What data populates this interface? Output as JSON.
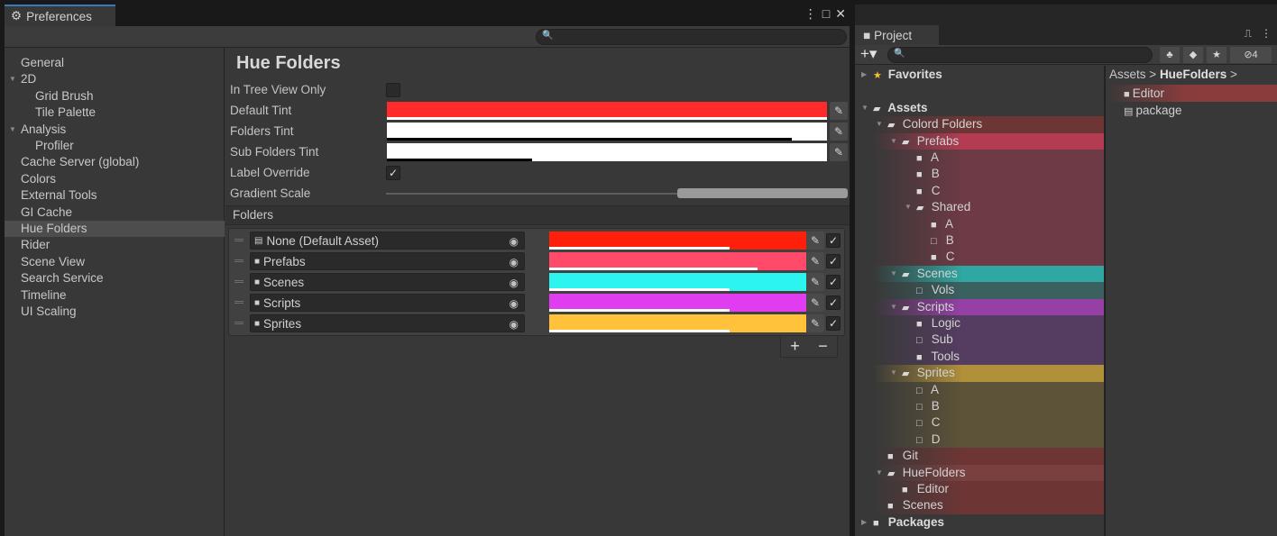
{
  "preferences": {
    "tab_title": "Preferences",
    "tab_icon": "gear-icon",
    "controls": [
      "⋮",
      "□",
      "✕"
    ],
    "sidebar": [
      {
        "label": "General",
        "indent": 0,
        "tri": ""
      },
      {
        "label": "2D",
        "indent": 0,
        "tri": "▼"
      },
      {
        "label": "Grid Brush",
        "indent": 1,
        "tri": ""
      },
      {
        "label": "Tile Palette",
        "indent": 1,
        "tri": ""
      },
      {
        "label": "Analysis",
        "indent": 0,
        "tri": "▼"
      },
      {
        "label": "Profiler",
        "indent": 1,
        "tri": ""
      },
      {
        "label": "Cache Server (global)",
        "indent": 0,
        "tri": ""
      },
      {
        "label": "Colors",
        "indent": 0,
        "tri": ""
      },
      {
        "label": "External Tools",
        "indent": 0,
        "tri": ""
      },
      {
        "label": "GI Cache",
        "indent": 0,
        "tri": ""
      },
      {
        "label": "Hue Folders",
        "indent": 0,
        "tri": "",
        "selected": true
      },
      {
        "label": "Rider",
        "indent": 0,
        "tri": ""
      },
      {
        "label": "Scene View",
        "indent": 0,
        "tri": ""
      },
      {
        "label": "Search Service",
        "indent": 0,
        "tri": ""
      },
      {
        "label": "Timeline",
        "indent": 0,
        "tri": ""
      },
      {
        "label": "UI Scaling",
        "indent": 0,
        "tri": ""
      }
    ],
    "page_title": "Hue Folders",
    "settings": {
      "in_tree_view_only": {
        "label": "In Tree View Only",
        "checked": false
      },
      "default_tint": {
        "label": "Default Tint",
        "color": "#ff2b2b",
        "bar_fraction": 1.0
      },
      "folders_tint": {
        "label": "Folders Tint",
        "color": "#ffffff",
        "bar_fraction": 0.92
      },
      "sub_folders_tint": {
        "label": "Sub Folders Tint",
        "color": "#ffffff",
        "bar_fraction": 0.33
      },
      "label_override": {
        "label": "Label Override",
        "checked": true
      },
      "gradient_scale": {
        "label": "Gradient Scale",
        "min": 0.0,
        "max": 1.0,
        "range": [
          0.63,
          1.0
        ]
      }
    },
    "folders_section": "Folders",
    "folders": [
      {
        "name": "None (Default Asset)",
        "icon": "file-icon",
        "color": "#ff1f0a",
        "bar_fraction": 0.7,
        "checked": true
      },
      {
        "name": "Prefabs",
        "icon": "folder-icon",
        "color": "#ff4a6a",
        "bar_fraction": 0.81,
        "checked": true
      },
      {
        "name": "Scenes",
        "icon": "folder-icon",
        "color": "#2cf5ef",
        "bar_fraction": 0.7,
        "checked": true
      },
      {
        "name": "Scripts",
        "icon": "folder-icon",
        "color": "#e03cf0",
        "bar_fraction": 0.7,
        "checked": true
      },
      {
        "name": "Sprites",
        "icon": "folder-icon",
        "color": "#ffc23a",
        "bar_fraction": 0.7,
        "checked": true
      }
    ],
    "footer": {
      "add": "+",
      "remove": "−"
    }
  },
  "project": {
    "tab_title": "Project",
    "controls": [
      "⎍",
      "⋮"
    ],
    "add_button": "+▾",
    "hidden_count": "4",
    "tree": [
      {
        "label": "Favorites",
        "depth": 0,
        "tri": "▶",
        "icon": "star-icon",
        "bold": true,
        "tint": null
      },
      {
        "label": "",
        "depth": 0,
        "tri": "",
        "icon": "",
        "bold": false,
        "tint": null
      },
      {
        "label": "Assets",
        "depth": 0,
        "tri": "▼",
        "icon": "open-folder-icon",
        "bold": true,
        "tint": null
      },
      {
        "label": "Colord Folders",
        "depth": 1,
        "tri": "▼",
        "icon": "open-folder-icon",
        "bold": false,
        "tint": "#6e3535"
      },
      {
        "label": "Prefabs",
        "depth": 2,
        "tri": "▼",
        "icon": "open-folder-icon",
        "bold": false,
        "tint": "#b43c52"
      },
      {
        "label": "A",
        "depth": 3,
        "tri": "",
        "icon": "folder-icon",
        "bold": false,
        "tint": "#6e3a45"
      },
      {
        "label": "B",
        "depth": 3,
        "tri": "",
        "icon": "folder-icon",
        "bold": false,
        "tint": "#6e3a45"
      },
      {
        "label": "C",
        "depth": 3,
        "tri": "",
        "icon": "folder-icon",
        "bold": false,
        "tint": "#6e3a45"
      },
      {
        "label": "Shared",
        "depth": 3,
        "tri": "▼",
        "icon": "open-folder-icon",
        "bold": false,
        "tint": "#6e3a45"
      },
      {
        "label": "A",
        "depth": 4,
        "tri": "",
        "icon": "folder-icon",
        "bold": false,
        "tint": "#6e3a45"
      },
      {
        "label": "B",
        "depth": 4,
        "tri": "",
        "icon": "empty-folder-icon",
        "bold": false,
        "tint": "#6e3a45"
      },
      {
        "label": "C",
        "depth": 4,
        "tri": "",
        "icon": "folder-icon",
        "bold": false,
        "tint": "#6e3a45"
      },
      {
        "label": "Scenes",
        "depth": 2,
        "tri": "▼",
        "icon": "open-folder-icon",
        "bold": false,
        "tint": "#2fa8a4"
      },
      {
        "label": "Vols",
        "depth": 3,
        "tri": "",
        "icon": "empty-folder-icon",
        "bold": false,
        "tint": "#3a6160"
      },
      {
        "label": "Scripts",
        "depth": 2,
        "tri": "▼",
        "icon": "open-folder-icon",
        "bold": false,
        "tint": "#9640a6"
      },
      {
        "label": "Logic",
        "depth": 3,
        "tri": "",
        "icon": "folder-icon",
        "bold": false,
        "tint": "#553d62"
      },
      {
        "label": "Sub",
        "depth": 3,
        "tri": "",
        "icon": "empty-folder-icon",
        "bold": false,
        "tint": "#553d62"
      },
      {
        "label": "Tools",
        "depth": 3,
        "tri": "",
        "icon": "folder-icon",
        "bold": false,
        "tint": "#553d62"
      },
      {
        "label": "Sprites",
        "depth": 2,
        "tri": "▼",
        "icon": "open-folder-icon",
        "bold": false,
        "tint": "#b1903a"
      },
      {
        "label": "A",
        "depth": 3,
        "tri": "",
        "icon": "empty-folder-icon",
        "bold": false,
        "tint": "#5d5338"
      },
      {
        "label": "B",
        "depth": 3,
        "tri": "",
        "icon": "empty-folder-icon",
        "bold": false,
        "tint": "#5d5338"
      },
      {
        "label": "C",
        "depth": 3,
        "tri": "",
        "icon": "empty-folder-icon",
        "bold": false,
        "tint": "#5d5338"
      },
      {
        "label": "D",
        "depth": 3,
        "tri": "",
        "icon": "empty-folder-icon",
        "bold": false,
        "tint": "#5d5338"
      },
      {
        "label": "Git",
        "depth": 1,
        "tri": "",
        "icon": "folder-icon",
        "bold": false,
        "tint": "#6e3535"
      },
      {
        "label": "HueFolders",
        "depth": 1,
        "tri": "▼",
        "icon": "open-folder-icon",
        "bold": false,
        "tint": "#7a4040"
      },
      {
        "label": "Editor",
        "depth": 2,
        "tri": "",
        "icon": "folder-icon",
        "bold": false,
        "tint": "#6e3535"
      },
      {
        "label": "Scenes",
        "depth": 1,
        "tri": "",
        "icon": "folder-icon",
        "bold": false,
        "tint": "#6e3535"
      },
      {
        "label": "Packages",
        "depth": 0,
        "tri": "▶",
        "icon": "folder-icon",
        "bold": true,
        "tint": null
      }
    ],
    "breadcrumb": {
      "root": "Assets",
      "sep": ">",
      "current": "HueFolders",
      "trail": ">"
    },
    "contents": [
      {
        "label": "Editor",
        "icon": "folder-icon",
        "tint": "#8a3c3c"
      },
      {
        "label": "package",
        "icon": "file-icon",
        "tint": null
      }
    ]
  }
}
